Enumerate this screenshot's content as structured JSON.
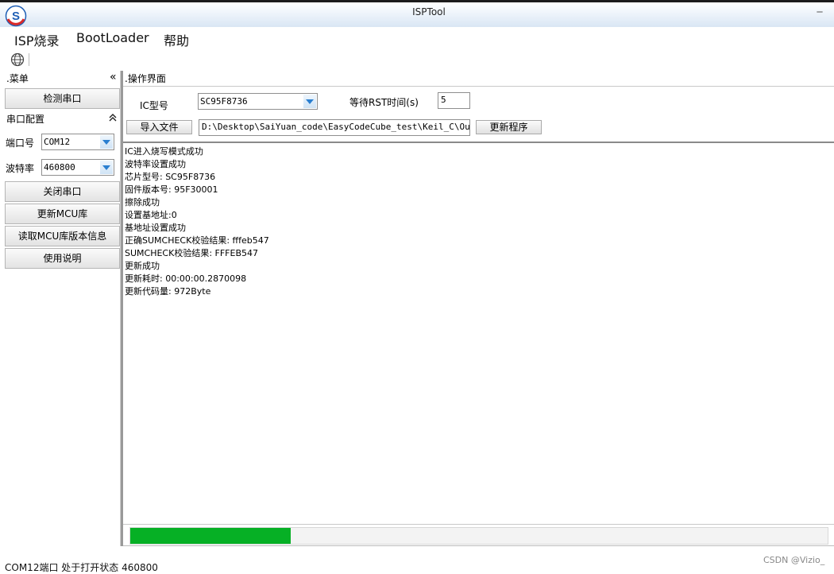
{
  "window": {
    "title": "ISPTool",
    "minimize": "_"
  },
  "menu": [
    "ISP烧录",
    "BootLoader",
    "帮助"
  ],
  "left_panel": {
    "header": ".菜单",
    "collapse_glyph": "«",
    "detect_button": "检测串口",
    "port_config_header": "串口配置",
    "port_config_glyph": "⌃",
    "port_label": "端口号",
    "port_value": "COM12",
    "baud_label": "波特率",
    "baud_value": "460800",
    "buttons": [
      "关闭串口",
      "更新MCU库",
      "读取MCU库版本信息",
      "使用说明"
    ]
  },
  "ops": {
    "header": ".操作界面",
    "ic_label": "IC型号",
    "ic_value": "SC95F8736",
    "rst_label": "等待RST时间(s)",
    "rst_value": "5",
    "import_button": "导入文件",
    "file_path": "D:\\Desktop\\SaiYuan_code\\EasyCodeCube_test\\Keil_C\\Output\\I",
    "update_button": "更新程序"
  },
  "log": [
    "IC进入烧写模式成功",
    "波特率设置成功",
    "芯片型号: SC95F8736",
    "固件版本号: 95F30001",
    "擦除成功",
    "设置基地址:0",
    "基地址设置成功",
    "正确SUMCHECK校验结果: fffeb547",
    "SUMCHECK校验结果: FFFEB547",
    "更新成功",
    "更新耗时: 00:00:00.2870098",
    "更新代码量: 972Byte"
  ],
  "progress": {
    "fraction": 0.23,
    "color": "#06b025"
  },
  "status": {
    "text": "COM12端口 处于打开状态 460800"
  },
  "watermark": "CSDN @Vizio_",
  "icons": {
    "app": "sc-logo-icon",
    "toolbar": "globe-icon"
  }
}
